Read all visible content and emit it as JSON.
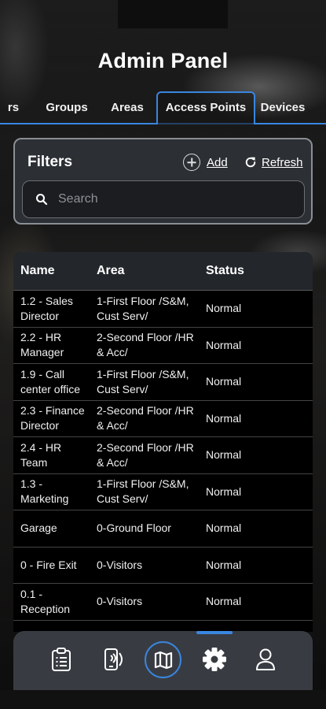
{
  "header": {
    "title": "Admin Panel"
  },
  "tabs": [
    {
      "label": "rs"
    },
    {
      "label": "Groups"
    },
    {
      "label": "Areas"
    },
    {
      "label": "Access Points",
      "active": true
    },
    {
      "label": "Devices"
    }
  ],
  "filters": {
    "title": "Filters",
    "add_label": "Add",
    "refresh_label": "Refresh",
    "search_placeholder": "Search",
    "search_value": ""
  },
  "table": {
    "columns": [
      "Name",
      "Area",
      "Status"
    ],
    "rows": [
      {
        "name": "1.2 - Sales Director",
        "area": "1-First Floor /S&M, Cust Serv/",
        "status": "Normal"
      },
      {
        "name": "2.2 - HR Manager",
        "area": "2-Second Floor /HR & Acc/",
        "status": "Normal"
      },
      {
        "name": "1.9 - Call center office",
        "area": "1-First Floor /S&M, Cust Serv/",
        "status": "Normal"
      },
      {
        "name": "2.3 - Finance Director",
        "area": "2-Second Floor /HR & Acc/",
        "status": "Normal"
      },
      {
        "name": "2.4 - HR Team",
        "area": "2-Second Floor /HR & Acc/",
        "status": "Normal"
      },
      {
        "name": "1.3 - Marketing",
        "area": "1-First Floor /S&M, Cust Serv/",
        "status": "Normal"
      },
      {
        "name": "Garage",
        "area": "0-Ground Floor",
        "status": "Normal"
      },
      {
        "name": "0 - Fire Exit",
        "area": "0-Visitors",
        "status": "Normal"
      },
      {
        "name": "0.1 - Reception",
        "area": "0-Visitors",
        "status": "Normal"
      }
    ]
  },
  "bottom_nav": {
    "items": [
      {
        "icon": "clipboard-icon"
      },
      {
        "icon": "phone-nfc-icon"
      },
      {
        "icon": "map-icon",
        "active": true
      },
      {
        "icon": "gear-icon"
      },
      {
        "icon": "user-icon"
      }
    ]
  },
  "colors": {
    "accent": "#3a86e0",
    "panel": "#2d3137",
    "nav": "#383c42"
  }
}
